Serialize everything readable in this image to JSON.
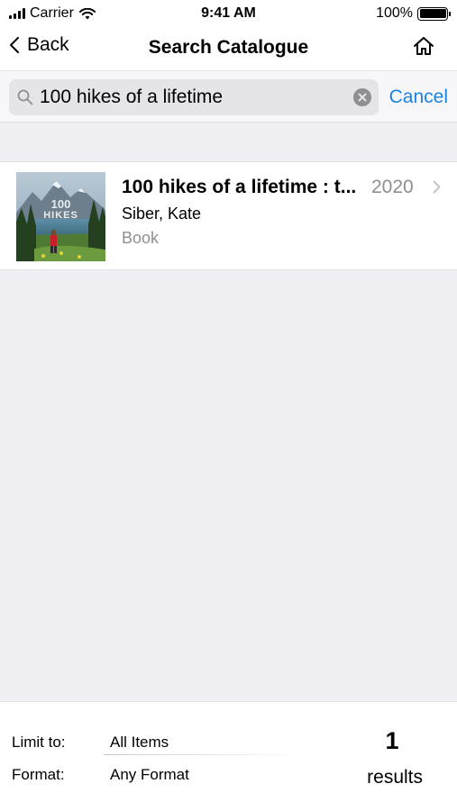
{
  "status_bar": {
    "carrier": "Carrier",
    "time": "9:41 AM",
    "battery": "100%",
    "battery_level": 1.0
  },
  "nav": {
    "back_label": "Back",
    "title": "Search Catalogue",
    "home_icon": "home-icon"
  },
  "search": {
    "query": "100 hikes of a lifetime",
    "cancel_label": "Cancel"
  },
  "results": [
    {
      "title": "100 hikes of a lifetime : t...",
      "year": "2020",
      "author": "Siber, Kate",
      "format": "Book",
      "cover_text_line1": "100",
      "cover_text_line2": "HIKES"
    }
  ],
  "footer": {
    "limit_label": "Limit to:",
    "limit_value": "All Items",
    "format_label": "Format:",
    "format_value": "Any Format",
    "results_count": "1",
    "results_label": "results"
  },
  "colors": {
    "accent": "#1a82e0",
    "secondary_text": "#8e8e93",
    "background": "#efeff4"
  }
}
